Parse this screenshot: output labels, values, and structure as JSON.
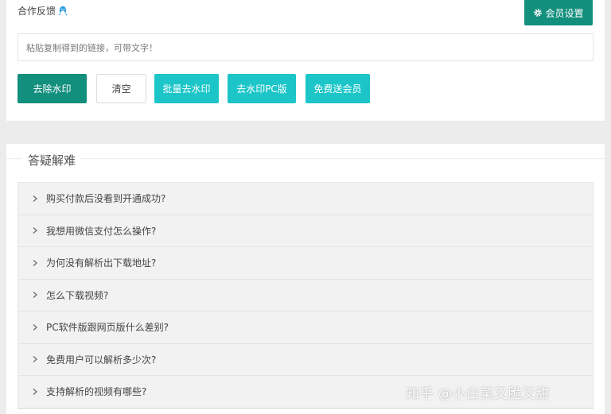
{
  "header": {
    "feedback_label": "合作反馈",
    "member_settings_label": "会员设置"
  },
  "input": {
    "placeholder": "粘贴复制得到的链接，可带文字！"
  },
  "buttons": {
    "remove_watermark": "去除水印",
    "clear": "清空",
    "batch_remove": "批量去水印",
    "pc_version": "去水印PC版",
    "free_membership": "免费送会员"
  },
  "faq": {
    "title": "答疑解难",
    "items": [
      "购买付款后没看到开通成功?",
      "我想用微信支付怎么操作?",
      "为何没有解析出下载地址?",
      "怎么下载视频?",
      "PC软件版跟网页版什么差别?",
      "免费用户可以解析多少次?",
      "支持解析的视频有哪些?"
    ]
  },
  "watermark": "知乎 @小白菜又脆又甜",
  "colors": {
    "primary": "#138f7e",
    "accent_cyan": "#1bc5c8",
    "qq_blue": "#2a9be0"
  }
}
